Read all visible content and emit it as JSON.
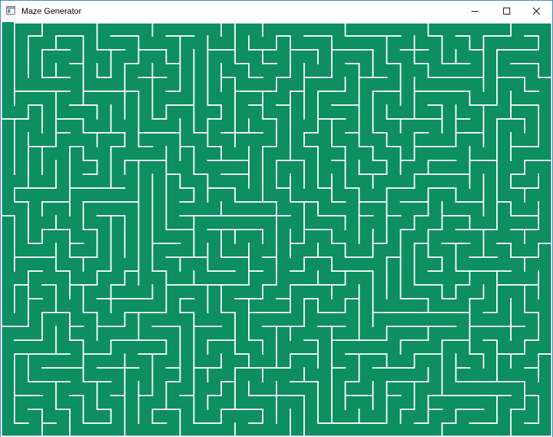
{
  "window": {
    "title": "Maze Generator",
    "icons": {
      "app": "app-window-icon",
      "minimize": "minimize-icon",
      "maximize": "maximize-icon",
      "close": "close-icon"
    }
  },
  "maze": {
    "columns": 40,
    "rows": 30,
    "colors": {
      "background": "#0d8f62",
      "walls": "#ffffff"
    }
  }
}
